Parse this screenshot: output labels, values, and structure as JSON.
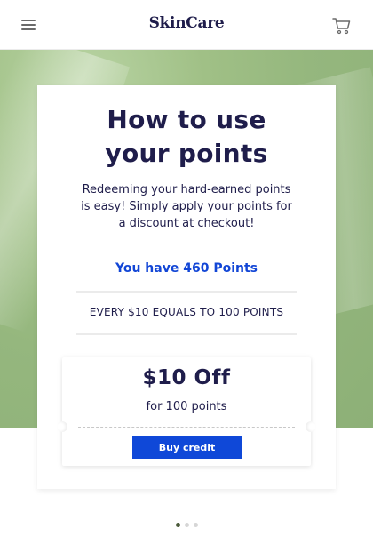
{
  "header": {
    "logo": "SkinCare",
    "menu_icon": "hamburger-menu-icon",
    "cart_icon": "shopping-cart-icon"
  },
  "card": {
    "title_line1": "How to use",
    "title_line2": "your points",
    "description": "Redeeming your hard-earned points is easy! Simply apply your points for a discount at checkout!",
    "points_balance": "You have 460 Points",
    "conversion": "EVERY $10 EQUALS TO 100 POINTS"
  },
  "coupon": {
    "amount": "$10 Off",
    "points_cost": "for 100 points",
    "button_label": "Buy credit"
  },
  "carousel": {
    "total_slides": 3,
    "active_slide": 1
  },
  "colors": {
    "brand_navy": "#1f1d4b",
    "accent_blue": "#0f48d8",
    "hero_green": "#9bbc83"
  }
}
